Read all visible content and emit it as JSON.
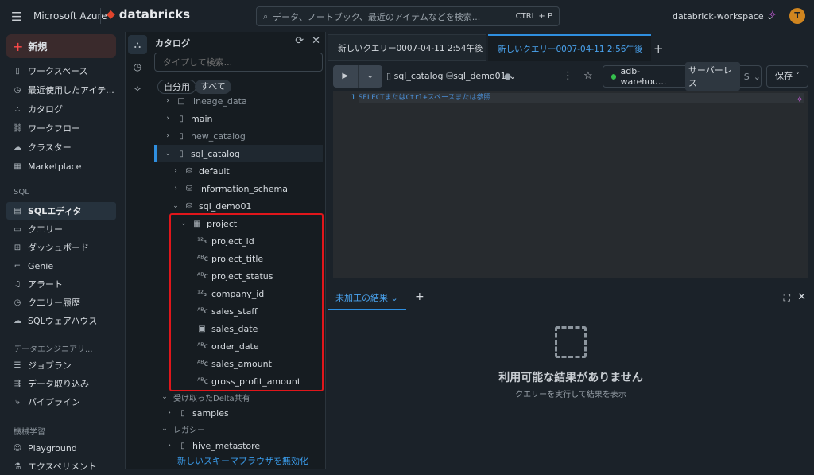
{
  "topbar": {
    "brand": "Microsoft Azure",
    "product": "databricks",
    "search_placeholder": "データ、ノートブック、最近のアイテムなどを検索...",
    "search_shortcut": "CTRL + P",
    "workspace": "databrick-workspace",
    "avatar": "T"
  },
  "sidebar": {
    "new_label": "新規",
    "items": [
      {
        "label": "ワークスペース",
        "icon": "▯"
      },
      {
        "label": "最近使用したアイテ...",
        "icon": "◷"
      },
      {
        "label": "カタログ",
        "icon": "⛬"
      },
      {
        "label": "ワークフロー",
        "icon": "⛓"
      },
      {
        "label": "クラスター",
        "icon": "☁"
      },
      {
        "label": "Marketplace",
        "icon": "▦"
      }
    ],
    "sql_section": "SQL",
    "sql_items": [
      {
        "label": "SQLエディタ",
        "icon": "▤"
      },
      {
        "label": "クエリー",
        "icon": "▭"
      },
      {
        "label": "ダッシュボード",
        "icon": "⊞"
      },
      {
        "label": "Genie",
        "icon": "⌐"
      },
      {
        "label": "アラート",
        "icon": "♫"
      },
      {
        "label": "クエリー履歴",
        "icon": "◷"
      },
      {
        "label": "SQLウェアハウス",
        "icon": "☁"
      }
    ],
    "de_section": "データエンジニアリ...",
    "de_items": [
      {
        "label": "ジョブラン",
        "icon": "☰"
      },
      {
        "label": "データ取り込み",
        "icon": "⇶"
      },
      {
        "label": "パイプライン",
        "icon": "⤷"
      }
    ],
    "ml_section": "機械学習",
    "ml_items": [
      {
        "label": "Playground",
        "icon": "☺"
      },
      {
        "label": "エクスペリメント",
        "icon": "⚗"
      }
    ]
  },
  "catalog": {
    "title": "カタログ",
    "search_placeholder": "タイプして検索...",
    "filter_mine": "自分用",
    "filter_all": "すべて",
    "tree": [
      {
        "label": "lineage_data",
        "indent": 0,
        "chev": "›",
        "icon": "□",
        "dim": true
      },
      {
        "label": "main",
        "indent": 0,
        "chev": "›",
        "icon": "▯"
      },
      {
        "label": "new_catalog",
        "indent": 0,
        "chev": "›",
        "icon": "▯",
        "dim": true
      },
      {
        "label": "sql_catalog",
        "indent": 0,
        "chev": "⌄",
        "icon": "▯",
        "selected": true
      },
      {
        "label": "default",
        "indent": 1,
        "chev": "›",
        "icon": "⛁"
      },
      {
        "label": "information_schema",
        "indent": 1,
        "chev": "›",
        "icon": "⛁"
      },
      {
        "label": "sql_demo01",
        "indent": 1,
        "chev": "⌄",
        "icon": "⛁"
      },
      {
        "label": "project",
        "indent": 2,
        "chev": "⌄",
        "icon": "▦"
      },
      {
        "label": "project_id",
        "indent": 3,
        "icon": "¹²₃"
      },
      {
        "label": "project_title",
        "indent": 3,
        "icon": "ᴬᴮc"
      },
      {
        "label": "project_status",
        "indent": 3,
        "icon": "ᴬᴮc"
      },
      {
        "label": "company_id",
        "indent": 3,
        "icon": "¹²₃"
      },
      {
        "label": "sales_staff",
        "indent": 3,
        "icon": "ᴬᴮc"
      },
      {
        "label": "sales_date",
        "indent": 3,
        "icon": "▣"
      },
      {
        "label": "order_date",
        "indent": 3,
        "icon": "ᴬᴮc"
      },
      {
        "label": "sales_amount",
        "indent": 3,
        "icon": "ᴬᴮc"
      },
      {
        "label": "gross_profit_amount",
        "indent": 3,
        "icon": "ᴬᴮc"
      }
    ],
    "delta_section": "受け取ったDelta共有",
    "samples": "samples",
    "legacy_section": "レガシー",
    "hive": "hive_metastore",
    "disable_link": "新しいスキーマブラウザを無効化"
  },
  "editor": {
    "tabs": [
      "新しいクエリー0007-04-11 2:54午後",
      "新しいクエリー0007-04-11 2:56午後"
    ],
    "catalog": "sql_catalog",
    "schema": "sql_demo01",
    "warehouse": "adb-warehou...",
    "warehouse_type": "サーバーレス",
    "warehouse_size": "S",
    "save": "保存",
    "line": "1",
    "placeholder": "SELECTまたはCtrl+スペースまたは参照"
  },
  "results": {
    "tab": "未加工の結果",
    "empty_title": "利用可能な結果がありません",
    "empty_sub": "クエリーを実行して結果を表示"
  }
}
